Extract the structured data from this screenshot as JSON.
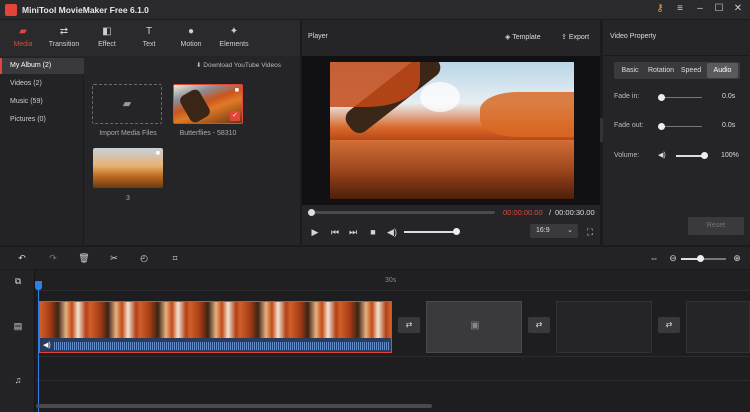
{
  "app": {
    "title": "MiniTool MovieMaker Free 6.1.0"
  },
  "toolbar": {
    "items": [
      {
        "label": "Media",
        "icon": "folder-icon"
      },
      {
        "label": "Transition",
        "icon": "transition-icon"
      },
      {
        "label": "Effect",
        "icon": "effect-icon"
      },
      {
        "label": "Text",
        "icon": "text-icon"
      },
      {
        "label": "Motion",
        "icon": "motion-icon"
      },
      {
        "label": "Elements",
        "icon": "elements-icon"
      }
    ],
    "active": "Media"
  },
  "sidebar": {
    "items": [
      {
        "label": "My Album (2)"
      },
      {
        "label": "Videos (2)"
      },
      {
        "label": "Music (59)"
      },
      {
        "label": "Pictures (0)"
      }
    ]
  },
  "media": {
    "download_label": "Download YouTube Videos",
    "import_label": "Import Media Files",
    "clip1_label": "Butterflies - 58310",
    "clip2_label": "3"
  },
  "player": {
    "title": "Player",
    "template_label": "Template",
    "export_label": "Export",
    "time_current": "00:00:00.00",
    "time_sep": "/",
    "time_total": "00:00:30.00",
    "aspect": "16:9",
    "progress": 0.0,
    "volume": 0.8
  },
  "property": {
    "title": "Video Property",
    "tabs": [
      "Basic",
      "Rotation",
      "Speed",
      "Audio"
    ],
    "active_tab": "Audio",
    "fade_in_label": "Fade in:",
    "fade_in_value": "0.0s",
    "fade_out_label": "Fade out:",
    "fade_out_value": "0.0s",
    "volume_label": "Volume:",
    "volume_value": "100%",
    "reset_label": "Reset"
  },
  "timeline": {
    "ruler_mark": "30s",
    "zoom": 0.5
  },
  "colors": {
    "accent": "#e2463a",
    "playhead": "#2f7fe8"
  }
}
